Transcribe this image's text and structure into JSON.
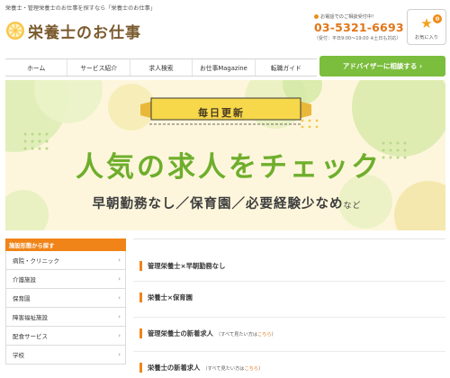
{
  "header": {
    "tagline": "栄養士・管理栄養士のお仕事を探すなら「栄養士のお仕事」",
    "logo_text": "栄養士のお仕事",
    "phone_caption": "お電話でのご相談受付中!",
    "phone_number": "03-5321-6693",
    "phone_hours": "（受付：平日9:00〜19:00 ※土日も対応）",
    "favorites_label": "お気に入り",
    "favorites_count": "0"
  },
  "nav": {
    "items": [
      "ホーム",
      "サービス紹介",
      "求人検索",
      "お仕事Magazine",
      "転職ガイド"
    ],
    "cta_label": "アドバイザーに相談する ›"
  },
  "hero": {
    "badge": "毎日更新",
    "headline": "人気の求人をチェック",
    "sub_main": "早朝勤務なし／保育園／必要経験少なめ",
    "sub_small": "など"
  },
  "sidebar": {
    "header": "施設形態から探す",
    "items": [
      "病院・クリニック",
      "介護施設",
      "保育園",
      "障害福祉施設",
      "配食サービス",
      "学校"
    ]
  },
  "main": {
    "sections": [
      {
        "title": "管理栄養士×早朝勤務なし",
        "note": "",
        "link": ""
      },
      {
        "title": "栄養士×保育園",
        "note": "",
        "link": ""
      },
      {
        "title": "管理栄養士の新着求人",
        "note": "（すべて見たい方は",
        "link": "こちら"
      },
      {
        "title": "栄養士の新着求人",
        "note": "（すべて見たい方は",
        "link": "こちら"
      }
    ],
    "note_close": "）"
  },
  "colors": {
    "accent_orange": "#f08418",
    "cta_green": "#7bbd3d",
    "headline_green": "#6fae2c",
    "hero_bg": "#fdf6dc",
    "badge_yellow": "#f6d84a"
  },
  "icons": {
    "logo": "lemon-slice-icon",
    "phone": "phone-dot-icon",
    "favorites": "star-icon",
    "sidebar_arrow": "chevron-right-icon"
  }
}
